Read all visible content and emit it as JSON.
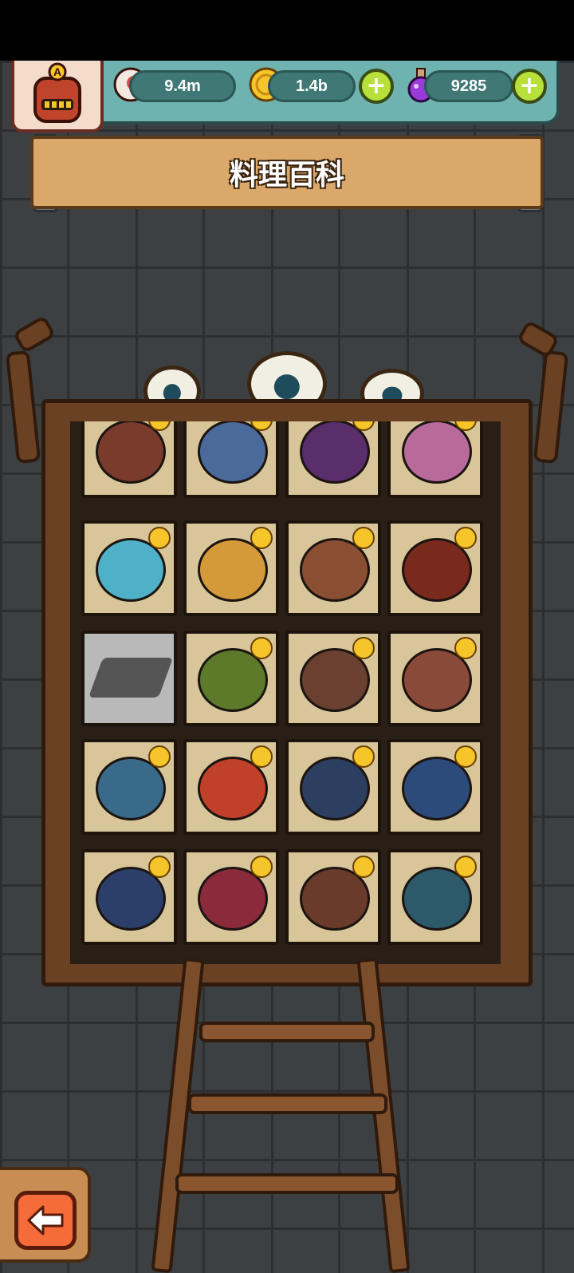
{
  "header": {
    "eyeballs_value": "9.4m",
    "coins_value": "1.4b",
    "potions_value": "9285",
    "avatar_letter": "A"
  },
  "title": "料理百科",
  "colors": {
    "resource_bar": "#6fb3b0",
    "banner": "#d9a86a",
    "frame": "#6b4124",
    "plus_button": "#b8e03a",
    "back_button": "#f56b3a"
  },
  "icons": {
    "eyeball": "eyeball-icon",
    "coin": "coin-icon",
    "potion": "potion-icon",
    "plus": "plus-icon",
    "back": "left-arrow-icon"
  },
  "recipes": [
    {
      "row": 0,
      "col": 0,
      "unlocked": true,
      "dish_color": "#7a3a2c"
    },
    {
      "row": 0,
      "col": 1,
      "unlocked": true,
      "dish_color": "#496a9a"
    },
    {
      "row": 0,
      "col": 2,
      "unlocked": true,
      "dish_color": "#5a2d6b"
    },
    {
      "row": 0,
      "col": 3,
      "unlocked": true,
      "dish_color": "#b86a9a"
    },
    {
      "row": 1,
      "col": 0,
      "unlocked": true,
      "dish_color": "#4fb1c7"
    },
    {
      "row": 1,
      "col": 1,
      "unlocked": true,
      "dish_color": "#d49a3a"
    },
    {
      "row": 1,
      "col": 2,
      "unlocked": true,
      "dish_color": "#8a4e32"
    },
    {
      "row": 1,
      "col": 3,
      "unlocked": true,
      "dish_color": "#7a2a1c"
    },
    {
      "row": 2,
      "col": 0,
      "unlocked": false,
      "dish_color": "#555555"
    },
    {
      "row": 2,
      "col": 1,
      "unlocked": true,
      "dish_color": "#5c7a2a"
    },
    {
      "row": 2,
      "col": 2,
      "unlocked": true,
      "dish_color": "#6a4030"
    },
    {
      "row": 2,
      "col": 3,
      "unlocked": true,
      "dish_color": "#8a4a3a"
    },
    {
      "row": 3,
      "col": 0,
      "unlocked": true,
      "dish_color": "#3a6a8a"
    },
    {
      "row": 3,
      "col": 1,
      "unlocked": true,
      "dish_color": "#c0402a"
    },
    {
      "row": 3,
      "col": 2,
      "unlocked": true,
      "dish_color": "#2c3f60"
    },
    {
      "row": 3,
      "col": 3,
      "unlocked": true,
      "dish_color": "#2c4a7a"
    },
    {
      "row": 4,
      "col": 0,
      "unlocked": true,
      "dish_color": "#2c3f6a"
    },
    {
      "row": 4,
      "col": 1,
      "unlocked": true,
      "dish_color": "#8a2a3a"
    },
    {
      "row": 4,
      "col": 2,
      "unlocked": true,
      "dish_color": "#6a3a2a"
    },
    {
      "row": 4,
      "col": 3,
      "unlocked": true,
      "dish_color": "#2c5a6a"
    }
  ]
}
